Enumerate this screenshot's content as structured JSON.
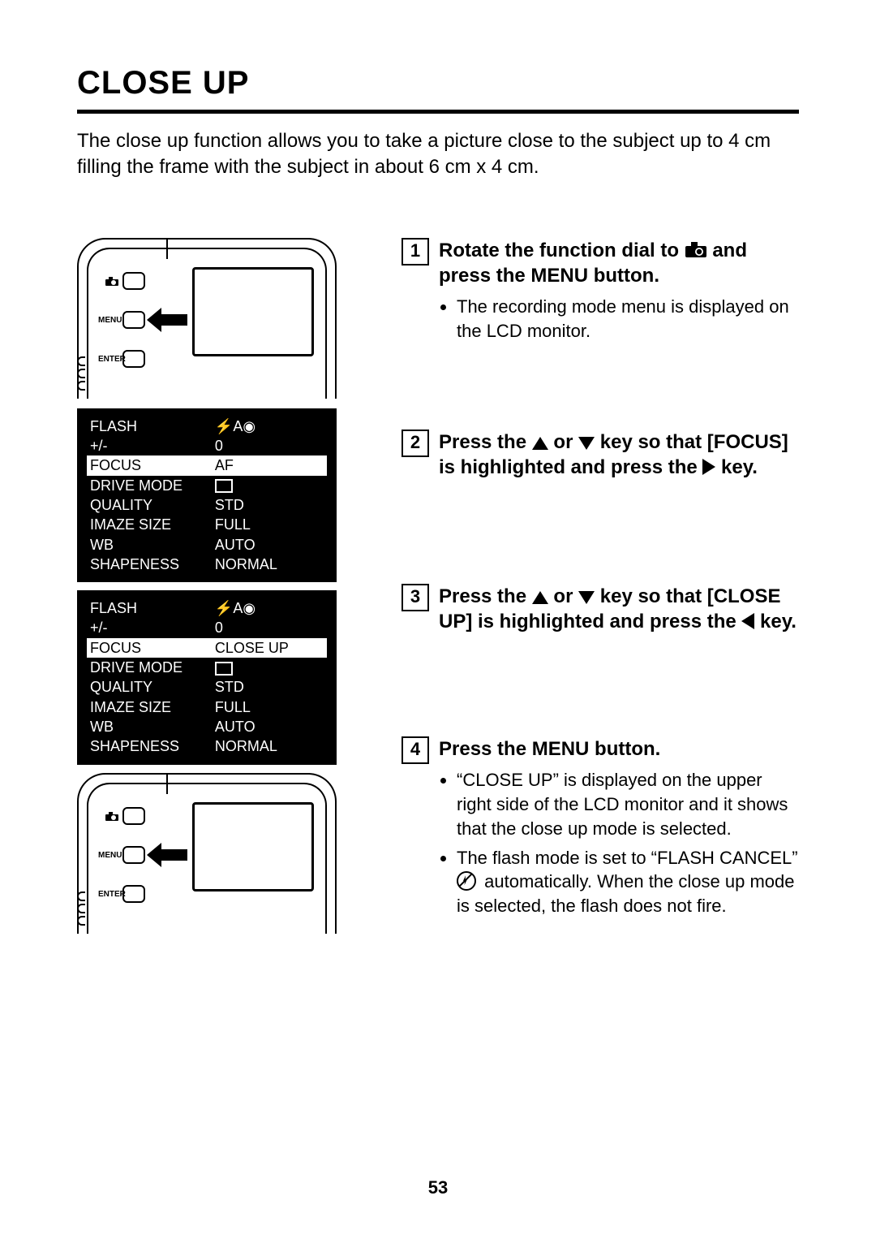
{
  "title": "CLOSE UP",
  "intro": "The close up function allows you to take a picture close to the subject up to 4 cm filling the frame with the subject in about 6 cm x 4 cm.",
  "cam_labels": {
    "icon": "",
    "menu": "MENU",
    "enter": "ENTER"
  },
  "menu_labels": {
    "flash": "FLASH",
    "ev": "+/-",
    "focus": "FOCUS",
    "drive": "DRIVE MODE",
    "quality": "QUALITY",
    "size": "IMAZE SIZE",
    "wb": "WB",
    "sharp": "SHAPENESS"
  },
  "menu1_values": {
    "flash": "⚡A◉",
    "ev": "0",
    "focus": "AF",
    "quality": "STD",
    "size": "FULL",
    "wb": "AUTO",
    "sharp": "NORMAL"
  },
  "menu2_values": {
    "flash": "⚡A◉",
    "ev": "0",
    "focus": "CLOSE UP",
    "quality": "STD",
    "size": "FULL",
    "wb": "AUTO",
    "sharp": "NORMAL"
  },
  "steps": {
    "s1": {
      "num": "1",
      "head_a": "Rotate the function dial to ",
      "head_b": " and press the MENU button.",
      "bullet1": "The recording mode menu is displayed on the LCD monitor."
    },
    "s2": {
      "num": "2",
      "head_a": "Press the ",
      "head_b": " or ",
      "head_c": " key so that [FOCUS] is highlighted and press the ",
      "head_d": " key."
    },
    "s3": {
      "num": "3",
      "head_a": "Press the ",
      "head_b": " or ",
      "head_c": " key so that [CLOSE UP] is highlighted and press the ",
      "head_d": " key."
    },
    "s4": {
      "num": "4",
      "head": "Press the MENU button.",
      "bullet1": "“CLOSE UP” is displayed on the upper right side of the LCD monitor and it shows that the close up mode is selected.",
      "bullet2a": "The flash mode is set to “FLASH CANCEL” ",
      "bullet2b": " automatically. When the close up mode is selected, the flash does not fire."
    }
  },
  "page_number": "53"
}
